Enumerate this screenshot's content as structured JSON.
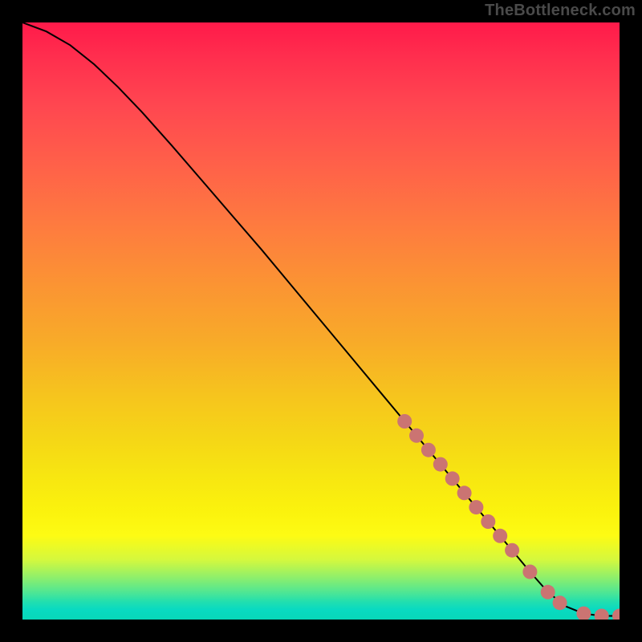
{
  "watermark": "TheBottleneck.com",
  "colors": {
    "dot": "#cb7472",
    "curve": "#000000"
  },
  "chart_data": {
    "type": "line",
    "title": "",
    "xlabel": "",
    "ylabel": "",
    "xlim": [
      0,
      100
    ],
    "ylim": [
      0,
      100
    ],
    "grid": false,
    "legend": false,
    "series": [
      {
        "name": "curve",
        "x": [
          0,
          4,
          8,
          12,
          16,
          20,
          25,
          30,
          35,
          40,
          45,
          50,
          55,
          60,
          65,
          70,
          75,
          80,
          85,
          88,
          91,
          94,
          97,
          100
        ],
        "y": [
          100,
          98.5,
          96.2,
          93.0,
          89.2,
          85.0,
          79.4,
          73.6,
          67.8,
          62.0,
          56.0,
          50.0,
          44.0,
          38.0,
          32.0,
          26.0,
          20.0,
          14.0,
          8.0,
          4.6,
          2.2,
          1.0,
          0.6,
          0.6
        ]
      }
    ],
    "dot_band": {
      "name": "highlighted-segment",
      "x": [
        64,
        66,
        68,
        70,
        72,
        74,
        76,
        78,
        80,
        82,
        85,
        88,
        90,
        94,
        97,
        100
      ],
      "y": [
        33.2,
        30.8,
        28.4,
        26.0,
        23.6,
        21.2,
        18.8,
        16.4,
        14.0,
        11.6,
        8.0,
        4.6,
        2.8,
        1.0,
        0.6,
        0.6
      ]
    }
  }
}
